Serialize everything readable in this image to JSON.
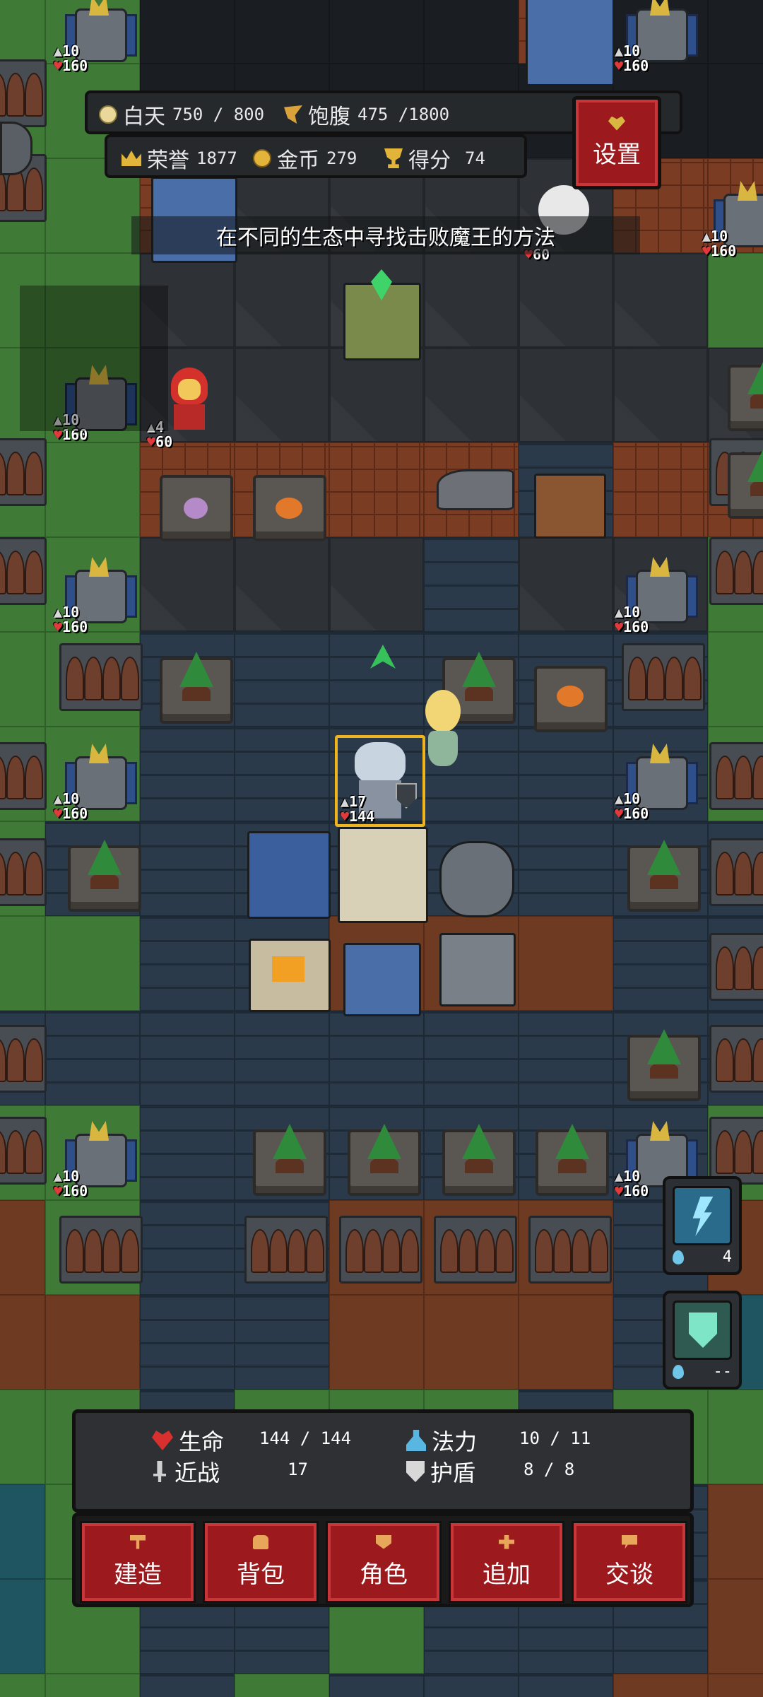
{
  "hud": {
    "day_label": "白天",
    "day_value": "750 / 800",
    "food_label": "饱腹",
    "food_value": "475 /1800",
    "honor_label": "荣誉",
    "honor_value": "1877",
    "gold_label": "金币",
    "gold_value": "279",
    "score_label": "得分",
    "score_value": "74"
  },
  "settings": {
    "label": "设置",
    "icon": "heart-icon"
  },
  "quest_text": "在不同的生态中寻找击败魔王的方法",
  "units": {
    "tower_attack": "10",
    "tower_hp": "160",
    "npc_attack": "4",
    "npc_hp": "60",
    "elder_hp": "60",
    "player_attack": "17",
    "player_hp": "144"
  },
  "skills": [
    {
      "name": "lightning-skill",
      "count": "4"
    },
    {
      "name": "shield-skill",
      "count": "--"
    }
  ],
  "stats": {
    "hp_label": "生命",
    "hp_value": "144 / 144",
    "mana_label": "法力",
    "mana_value": "10 / 11",
    "melee_label": "近战",
    "melee_value": "17",
    "shield_label": "护盾",
    "shield_value": "8 / 8"
  },
  "menu": [
    "建造",
    "背包",
    "角色",
    "追加",
    "交谈"
  ],
  "colors": {
    "button_red": "#9c1a1d",
    "panel": "#2e3033",
    "grass": "#3f7a36",
    "road": "#2a3a4a"
  }
}
